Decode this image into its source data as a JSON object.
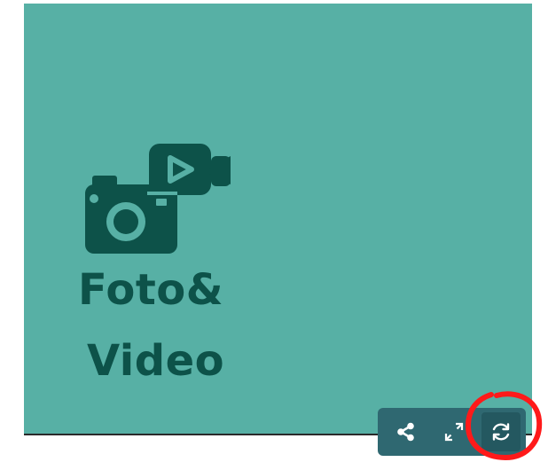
{
  "tile": {
    "logo_line_1": "Foto&",
    "logo_line_2": "Video",
    "logo_icon": "camera-with-video-camera-icon"
  },
  "toolbar": {
    "share_icon": "share-icon",
    "fullscreen_icon": "expand-icon",
    "refresh_icon": "refresh-icon"
  },
  "annotation": {
    "type": "hand-drawn circle around refresh button",
    "color": "#ff1a1a"
  },
  "colors": {
    "tile_background": "#57b0a5",
    "logo": "#0d5249",
    "toolbar": "#2f6871"
  }
}
